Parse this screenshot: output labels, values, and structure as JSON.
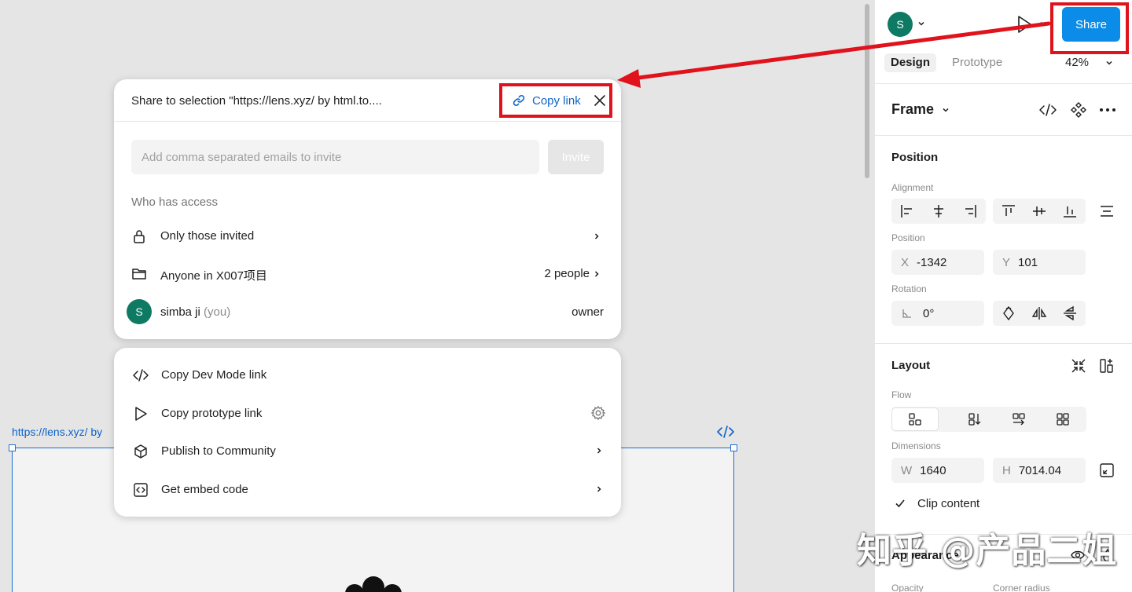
{
  "canvas": {
    "frame_label": "https://lens.xyz/ by",
    "frame_code_icon": "code-icon"
  },
  "toolbar": {
    "avatar_initial": "S",
    "share_label": "Share",
    "tabs": [
      {
        "label": "Design",
        "active": true
      },
      {
        "label": "Prototype",
        "active": false
      }
    ],
    "zoom": "42%"
  },
  "design_panel": {
    "frame_title": "Frame",
    "position_section": "Position",
    "alignment_label": "Alignment",
    "position_label": "Position",
    "x_prefix": "X",
    "x_value": "-1342",
    "y_prefix": "Y",
    "y_value": "101",
    "rotation_label": "Rotation",
    "rotation_value": "0°",
    "layout_section": "Layout",
    "flow_label": "Flow",
    "dimensions_label": "Dimensions",
    "w_prefix": "W",
    "w_value": "1640",
    "h_prefix": "H",
    "h_value": "7014.04",
    "clip_content": "Clip content",
    "clip_checked": true,
    "appearance_section": "Appearance",
    "opacity_label": "Opacity",
    "corner_radius_label": "Corner radius"
  },
  "share_dialog": {
    "title": "Share to selection \"https://lens.xyz/ by html.to....",
    "copy_link": "Copy link",
    "invite_placeholder": "Add comma separated emails to invite",
    "invite_button": "Invite",
    "who_has_access": "Who has access",
    "access_rows": [
      {
        "icon": "lock-icon",
        "label": "Only those invited",
        "right": ""
      },
      {
        "icon": "folder-icon",
        "label": "Anyone in X007项目",
        "right": "2 people"
      }
    ],
    "owner": {
      "initial": "S",
      "name": "simba ji",
      "you": "(you)",
      "role": "owner"
    }
  },
  "links_menu": {
    "items": [
      {
        "icon": "code-icon",
        "label": "Copy Dev Mode link"
      },
      {
        "icon": "play-icon",
        "label": "Copy prototype link"
      },
      {
        "icon": "community-icon",
        "label": "Publish to Community"
      },
      {
        "icon": "embed-icon",
        "label": "Get embed code"
      }
    ]
  },
  "watermark": "知乎 @产品二姐",
  "colors": {
    "accent": "#0c8ce9",
    "link": "#0d63c9",
    "avatar": "#0f7a63",
    "highlight": "#e0121c"
  }
}
